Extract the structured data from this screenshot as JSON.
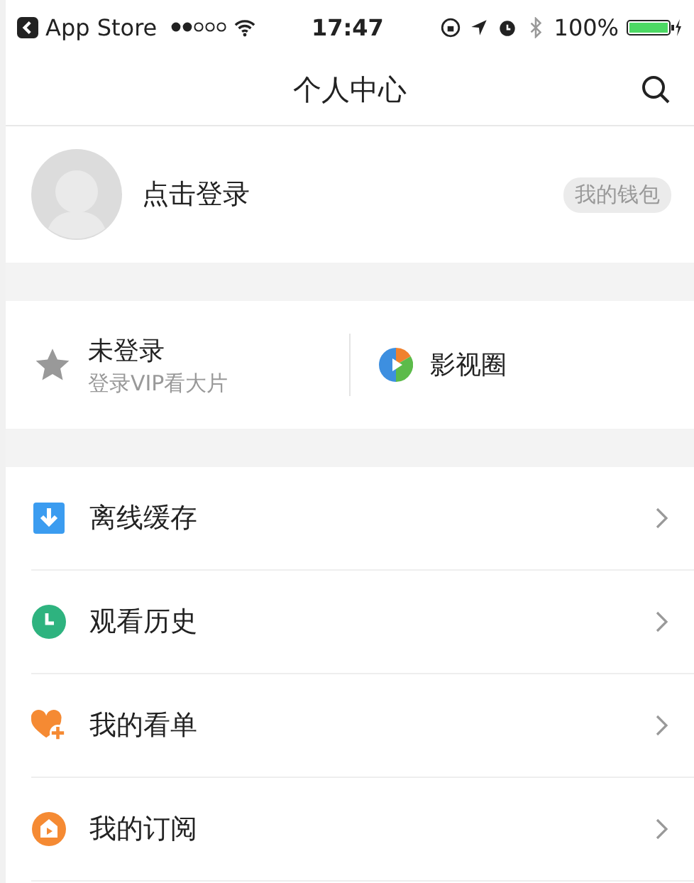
{
  "status_bar": {
    "back_label": "App Store",
    "time": "17:47",
    "battery": "100%"
  },
  "nav": {
    "title": "个人中心"
  },
  "profile": {
    "login_label": "点击登录",
    "wallet": "我的钱包"
  },
  "vip": {
    "title": "未登录",
    "subtitle": "登录VIP看大片",
    "circle_label": "影视圈"
  },
  "menu": [
    {
      "kind": "download",
      "label": "离线缓存"
    },
    {
      "kind": "history",
      "label": "观看历史"
    },
    {
      "kind": "watchlist",
      "label": "我的看单"
    },
    {
      "kind": "subscribe",
      "label": "我的订阅"
    }
  ]
}
